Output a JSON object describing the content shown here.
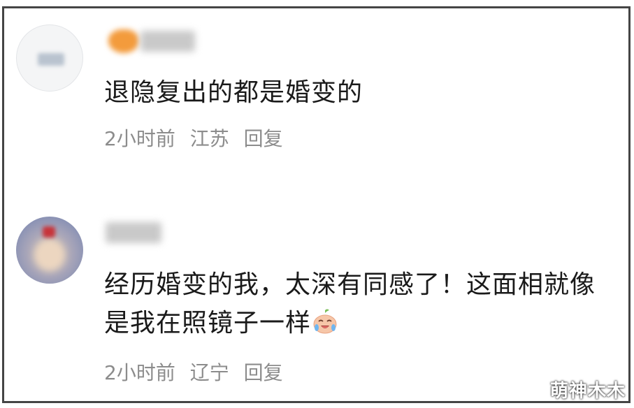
{
  "comments": [
    {
      "text": "退隐复出的都是婚变的",
      "meta": {
        "time": "2小时前",
        "location": "江苏",
        "reply_label": "回复"
      }
    },
    {
      "text": "经历婚变的我，太深有同感了！这面相就像是我在照镜子一样",
      "emoji": "laugh-cry-peach-emoji",
      "meta": {
        "time": "2小时前",
        "location": "辽宁",
        "reply_label": "回复"
      }
    }
  ],
  "watermark": "萌神木木",
  "colors": {
    "text": "#1a1a1a",
    "meta": "#8c8c8c",
    "border": "#454545"
  }
}
